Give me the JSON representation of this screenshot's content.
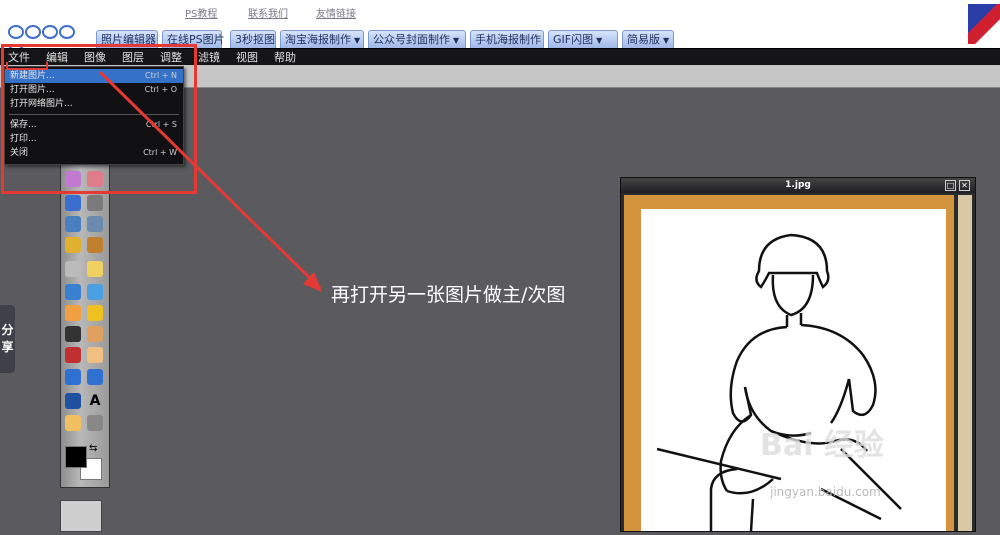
{
  "header": {
    "top_links": [
      "PS教程",
      "联系我们",
      "友情链接"
    ],
    "nav_tabs": [
      {
        "label": "照片编辑器",
        "dropdown": false
      },
      {
        "label": "在线PS图片",
        "dropdown": false
      },
      {
        "label": "3秒抠图",
        "dropdown": false
      },
      {
        "label": "淘宝海报制作",
        "dropdown": true
      },
      {
        "label": "公众号封面制作",
        "dropdown": true
      },
      {
        "label": "手机海报制作",
        "dropdown": false
      },
      {
        "label": "GIF闪图",
        "dropdown": true
      },
      {
        "label": "简易版",
        "dropdown": true
      }
    ]
  },
  "menubar": {
    "items": [
      "文件",
      "编辑",
      "图像",
      "图层",
      "调整",
      "滤镜",
      "视图",
      "帮助"
    ]
  },
  "file_menu": {
    "items": [
      {
        "label": "新建图片...",
        "shortcut": "Ctrl + N",
        "active": true
      },
      {
        "label": "打开图片...",
        "shortcut": "Ctrl + O",
        "active": false
      },
      {
        "label": "打开网络图片...",
        "shortcut": "",
        "active": false
      },
      {
        "label": "保存...",
        "shortcut": "Ctrl + S",
        "active": false
      },
      {
        "label": "打印...",
        "shortcut": "",
        "active": false
      },
      {
        "label": "关闭",
        "shortcut": "Ctrl + W",
        "active": false
      }
    ]
  },
  "annotation": {
    "text": "再打开另一张图片做主/次图",
    "color": "#e53935"
  },
  "share_tab": {
    "chars": [
      "分",
      "享"
    ]
  },
  "tools": [
    "crop-icon",
    "move-icon",
    "wand-icon",
    "eraser-icon",
    "gradient-icon",
    "brush-icon",
    "clone-icon",
    "smudge-icon",
    "pencil-icon",
    "stamp-icon",
    "bucket-icon",
    "shape-icon",
    "blur-icon",
    "sharpen-icon",
    "lasso-icon",
    "sponge-icon",
    "dodge-icon",
    "burn-icon",
    "redeye-icon",
    "bandage-icon",
    "transform-icon",
    "liquify-icon",
    "picker-icon",
    "text-icon",
    "hand-icon",
    "zoom-icon"
  ],
  "colors": {
    "foreground": "#000000",
    "background": "#ffffff",
    "canvas_border": "#d4943e"
  },
  "document": {
    "title": "1.jpg"
  },
  "watermark": {
    "text": "Bai 经验",
    "url": "jingyan.baidu.com"
  }
}
